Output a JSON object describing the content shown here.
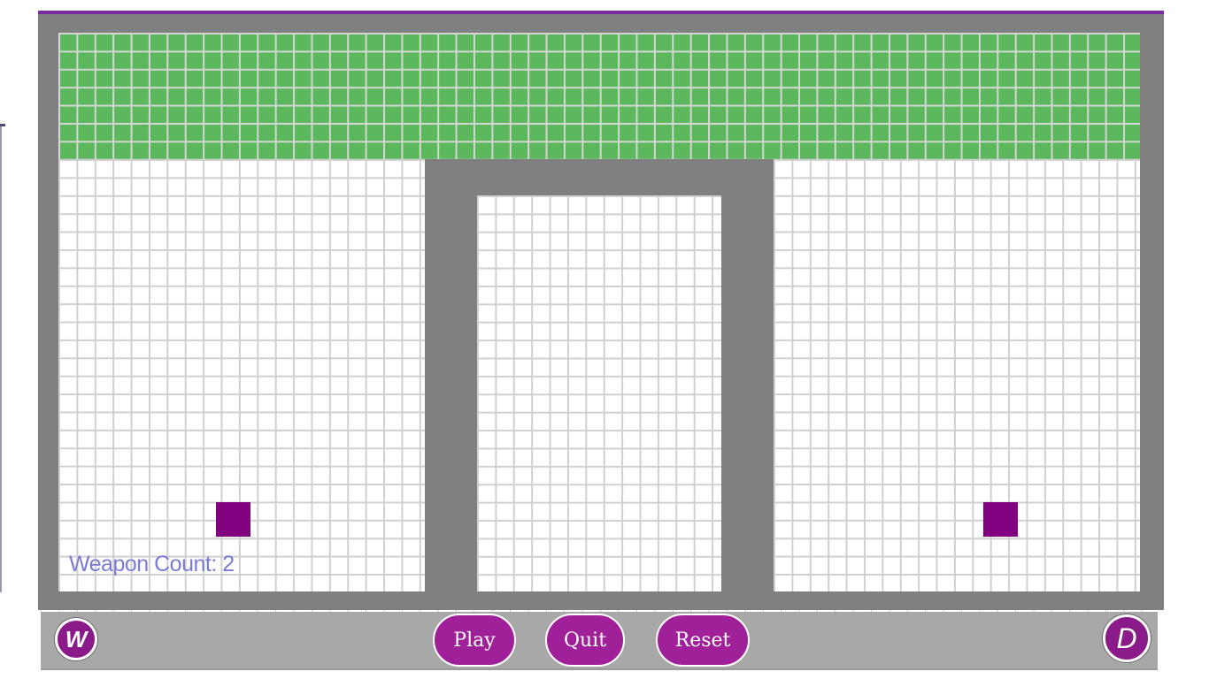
{
  "hud": {
    "weapon_count_label": "Weapon Count: 2"
  },
  "controls": {
    "left_key_label": "W",
    "right_key_label": "D",
    "play_label": "Play",
    "quit_label": "Quit",
    "reset_label": "Reset"
  },
  "colors": {
    "grass": "#5cb85c",
    "wall": "#808080",
    "player": "#800080",
    "button": "#a0209a",
    "accent_border": "#7a2aa0",
    "hud_text": "#7b7bd6"
  },
  "icons": {
    "player_tokens": "square-token"
  }
}
